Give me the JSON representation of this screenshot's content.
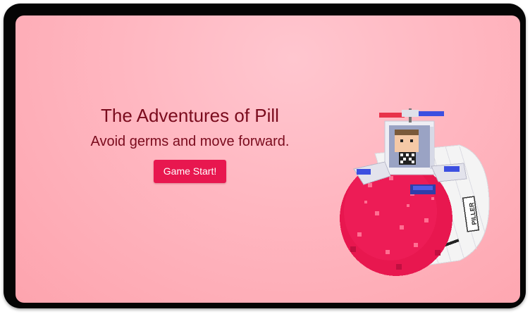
{
  "game": {
    "title": "The Adventures of Pill",
    "subtitle": "Avoid germs and move forward.",
    "start_button_label": "Game Start!"
  },
  "character": {
    "name": "pill-submarine-character",
    "capsule_label": "PILLER"
  },
  "colors": {
    "background": "#ffb6c0",
    "title_text": "#7a0b1d",
    "button": "#e8174f",
    "capsule_red": "#e8174f",
    "capsule_white": "#f4f4f4",
    "siren_red": "#e8334a",
    "siren_blue": "#3c4fe0"
  }
}
